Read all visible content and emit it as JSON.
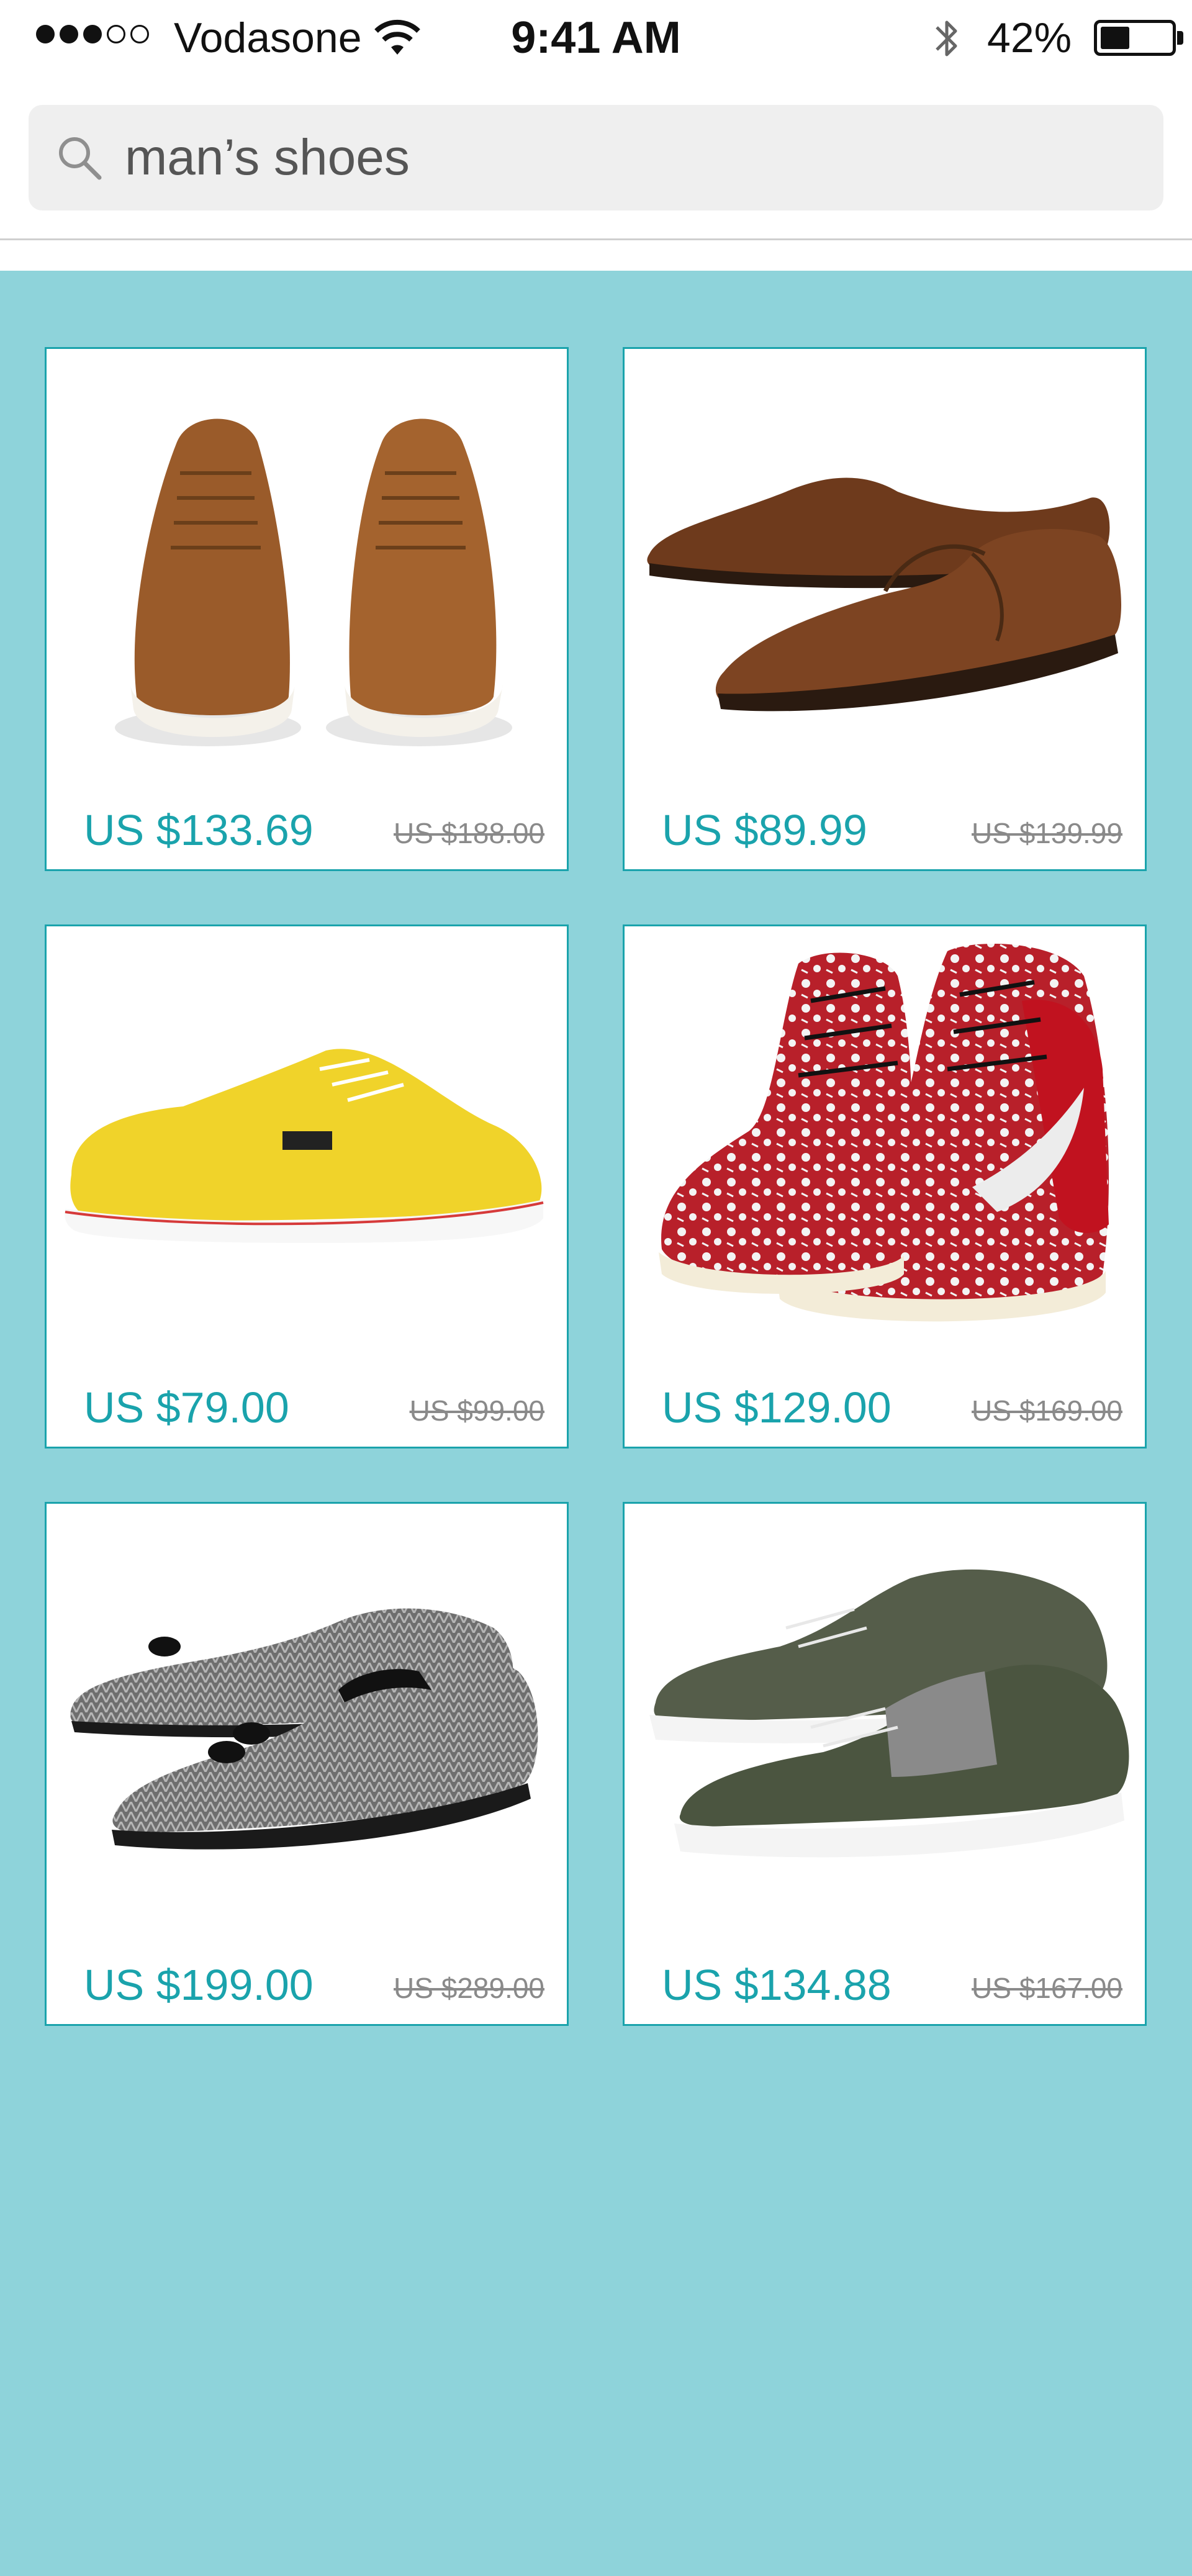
{
  "status_bar": {
    "carrier": "Vodasone",
    "time": "9:41 AM",
    "battery_percent": "42%",
    "battery_level": 0.42,
    "signal_bars_filled": 3,
    "signal_bars_total": 5,
    "icons": [
      "wifi-icon",
      "bluetooth-icon",
      "battery-icon"
    ]
  },
  "search": {
    "query": "man’s shoes",
    "icon": "search-icon"
  },
  "colors": {
    "accent": "#1aa3ac",
    "results_background": "#8ed3da",
    "search_field_background": "#efefef"
  },
  "products": [
    {
      "price": "US $133.69",
      "original_price": "US $188.00",
      "image": "brown-suede-sneakers"
    },
    {
      "price": "US $89.99",
      "original_price": "US $139.99",
      "image": "brown-leather-oxford-shoes"
    },
    {
      "price": "US $79.00",
      "original_price": "US $99.00",
      "image": "yellow-canvas-sneaker"
    },
    {
      "price": "US $129.00",
      "original_price": "US $169.00",
      "image": "red-floral-high-top-sneakers"
    },
    {
      "price": "US $199.00",
      "original_price": "US $289.00",
      "image": "grey-tweed-tassel-loafers"
    },
    {
      "price": "US $134.88",
      "original_price": "US $167.00",
      "image": "green-grey-leather-sneakers"
    }
  ]
}
